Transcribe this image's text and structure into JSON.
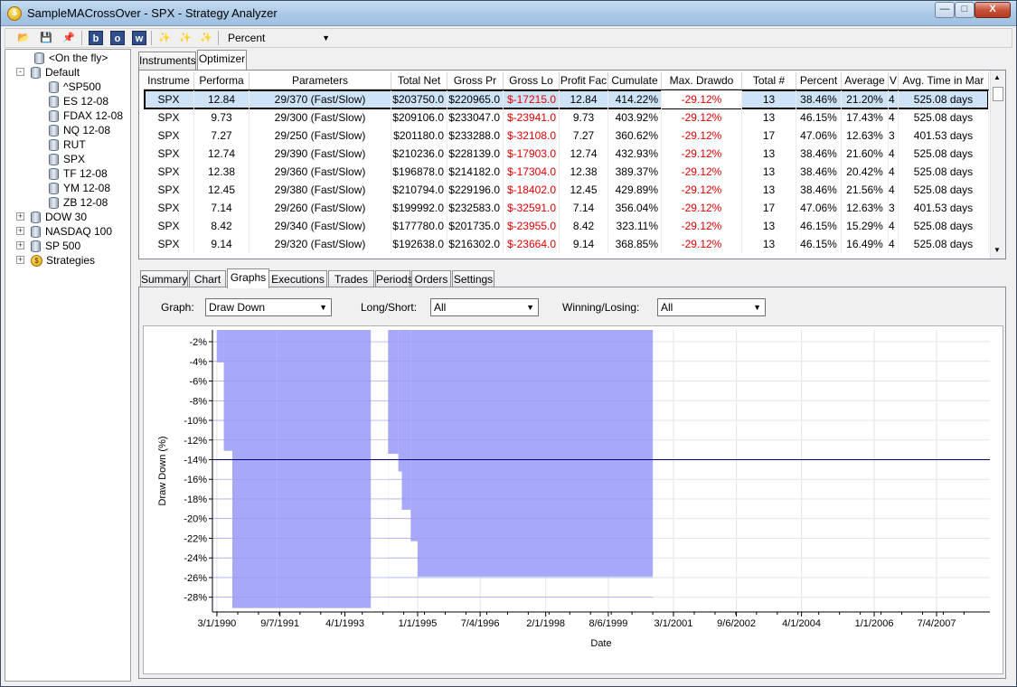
{
  "window": {
    "title": "SampleMACrossOver - SPX - Strategy Analyzer",
    "icon": "strategy-icon",
    "minimize": "—",
    "maximize": "□",
    "close": "X"
  },
  "toolbar": {
    "performance_unit": "Percent",
    "icons": [
      "open-folder-icon",
      "save-icon",
      "pin-icon",
      "b-icon",
      "o-icon",
      "w-icon",
      "wand-icon",
      "wand2-icon",
      "wand3-icon"
    ]
  },
  "tree": {
    "items": [
      {
        "label": "<On the fly>",
        "level": 1,
        "icon": "database-icon"
      },
      {
        "label": "Default",
        "level": 0,
        "expander": "-",
        "icon": "database-icon"
      },
      {
        "label": "^SP500",
        "level": 2,
        "icon": "database-icon"
      },
      {
        "label": "ES 12-08",
        "level": 2,
        "icon": "database-icon"
      },
      {
        "label": "FDAX 12-08",
        "level": 2,
        "icon": "database-icon"
      },
      {
        "label": "NQ 12-08",
        "level": 2,
        "icon": "database-icon"
      },
      {
        "label": "RUT",
        "level": 2,
        "icon": "database-icon"
      },
      {
        "label": "SPX",
        "level": 2,
        "icon": "database-icon"
      },
      {
        "label": "TF 12-08",
        "level": 2,
        "icon": "database-icon"
      },
      {
        "label": "YM 12-08",
        "level": 2,
        "icon": "database-icon"
      },
      {
        "label": "ZB 12-08",
        "level": 2,
        "icon": "database-icon"
      },
      {
        "label": "DOW 30",
        "level": 0,
        "expander": "+",
        "icon": "database-icon"
      },
      {
        "label": "NASDAQ 100",
        "level": 0,
        "expander": "+",
        "icon": "database-icon"
      },
      {
        "label": "SP 500",
        "level": 0,
        "expander": "+",
        "icon": "database-icon"
      },
      {
        "label": "Strategies",
        "level": 0,
        "expander": "+",
        "icon": "strategy-icon"
      }
    ]
  },
  "top_tabs": [
    "Instruments",
    "Optimizer"
  ],
  "grid": {
    "columns": [
      "Instrume",
      "Performa",
      "Parameters",
      "Total Net",
      "Gross Pr",
      "Gross Lo",
      "Profit Fac",
      "Cumulate",
      "Max. Drawdo",
      "Total #",
      "Percent",
      "Average",
      "V",
      "Avg. Time in Mar"
    ],
    "rows": [
      [
        "SPX",
        "12.84",
        "29/370 (Fast/Slow)",
        "$203750.0",
        "$220965.0",
        "$-17215.0",
        "12.84",
        "414.22%",
        "-29.12%",
        "13",
        "38.46%",
        "21.20%",
        "4",
        "525.08 days"
      ],
      [
        "SPX",
        "9.73",
        "29/300 (Fast/Slow)",
        "$209106.0",
        "$233047.0",
        "$-23941.0",
        "9.73",
        "403.92%",
        "-29.12%",
        "13",
        "46.15%",
        "17.43%",
        "4",
        "525.08 days"
      ],
      [
        "SPX",
        "7.27",
        "29/250 (Fast/Slow)",
        "$201180.0",
        "$233288.0",
        "$-32108.0",
        "7.27",
        "360.62%",
        "-29.12%",
        "17",
        "47.06%",
        "12.63%",
        "3",
        "401.53 days"
      ],
      [
        "SPX",
        "12.74",
        "29/390 (Fast/Slow)",
        "$210236.0",
        "$228139.0",
        "$-17903.0",
        "12.74",
        "432.93%",
        "-29.12%",
        "13",
        "38.46%",
        "21.60%",
        "4",
        "525.08 days"
      ],
      [
        "SPX",
        "12.38",
        "29/360 (Fast/Slow)",
        "$196878.0",
        "$214182.0",
        "$-17304.0",
        "12.38",
        "389.37%",
        "-29.12%",
        "13",
        "38.46%",
        "20.42%",
        "4",
        "525.08 days"
      ],
      [
        "SPX",
        "12.45",
        "29/380 (Fast/Slow)",
        "$210794.0",
        "$229196.0",
        "$-18402.0",
        "12.45",
        "429.89%",
        "-29.12%",
        "13",
        "38.46%",
        "21.56%",
        "4",
        "525.08 days"
      ],
      [
        "SPX",
        "7.14",
        "29/260 (Fast/Slow)",
        "$199992.0",
        "$232583.0",
        "$-32591.0",
        "7.14",
        "356.04%",
        "-29.12%",
        "17",
        "47.06%",
        "12.63%",
        "3",
        "401.53 days"
      ],
      [
        "SPX",
        "8.42",
        "29/340 (Fast/Slow)",
        "$177780.0",
        "$201735.0",
        "$-23955.0",
        "8.42",
        "323.11%",
        "-29.12%",
        "13",
        "46.15%",
        "15.29%",
        "4",
        "525.08 days"
      ],
      [
        "SPX",
        "9.14",
        "29/320 (Fast/Slow)",
        "$192638.0",
        "$216302.0",
        "$-23664.0",
        "9.14",
        "368.85%",
        "-29.12%",
        "13",
        "46.15%",
        "16.49%",
        "4",
        "525.08 days"
      ]
    ]
  },
  "bottom_tabs": [
    "Summary",
    "Chart",
    "Graphs",
    "Executions",
    "Trades",
    "Periods",
    "Orders",
    "Settings"
  ],
  "filters": {
    "graph_label": "Graph:",
    "graph_value": "Draw Down",
    "longshort_label": "Long/Short:",
    "longshort_value": "All",
    "winlose_label": "Winning/Losing:",
    "winlose_value": "All"
  },
  "chart_data": {
    "type": "area",
    "xlabel": "Date",
    "ylabel": "Draw Down (%)",
    "ylim": [
      -29.5,
      -0.8
    ],
    "yticks": [
      -2,
      -4,
      -6,
      -8,
      -10,
      -12,
      -14,
      -16,
      -18,
      -20,
      -22,
      -24,
      -26,
      -28
    ],
    "ytick_labels": [
      "-2%",
      "-4%",
      "-6%",
      "-8%",
      "-10%",
      "-12%",
      "-14%",
      "-16%",
      "-18%",
      "-20%",
      "-22%",
      "-24%",
      "-26%",
      "-28%"
    ],
    "xlim": [
      "1990-01-21",
      "2008-10-15"
    ],
    "xticks": [
      "1990-03-01",
      "1991-09-07",
      "1993-04-01",
      "1995-01-01",
      "1996-07-04",
      "1998-02-01",
      "1999-08-06",
      "2001-03-01",
      "2002-09-06",
      "2004-04-01",
      "2006-01-01",
      "2007-07-04"
    ],
    "xtick_labels": [
      "3/1/1990",
      "9/7/1991",
      "4/1/1993",
      "1/1/1995",
      "7/4/1996",
      "2/1/1998",
      "8/6/1999",
      "3/1/2001",
      "9/6/2002",
      "4/1/2004",
      "1/1/2006",
      "7/4/2007"
    ],
    "series": [
      {
        "steps": [
          {
            "start": "1990-03-01",
            "end": "1990-05-01",
            "value": -4.1
          },
          {
            "start": "1990-05-01",
            "end": "1990-07-15",
            "value": -13.1
          },
          {
            "start": "1990-07-15",
            "end": "1991-08-15",
            "value": -29.1
          },
          {
            "start": "1991-08-15",
            "end": "1994-04-15",
            "value": -29.1
          },
          {
            "start": "1994-04-15",
            "end": "1994-07-15",
            "value": -13.4
          },
          {
            "start": "1994-07-15",
            "end": "1994-08-15",
            "value": -15.2
          },
          {
            "start": "1994-08-15",
            "end": "1994-11-01",
            "value": -19.1
          },
          {
            "start": "1994-11-01",
            "end": "1995-01-01",
            "value": -22.3
          },
          {
            "start": "1995-01-01",
            "end": "2000-09-01",
            "value": -25.9
          }
        ]
      }
    ],
    "gap": {
      "start": "1993-11-15",
      "end": "1994-04-15"
    },
    "reference_line": -14.0,
    "fill_color": "#a8a8f8",
    "line_color": "#00008b"
  }
}
